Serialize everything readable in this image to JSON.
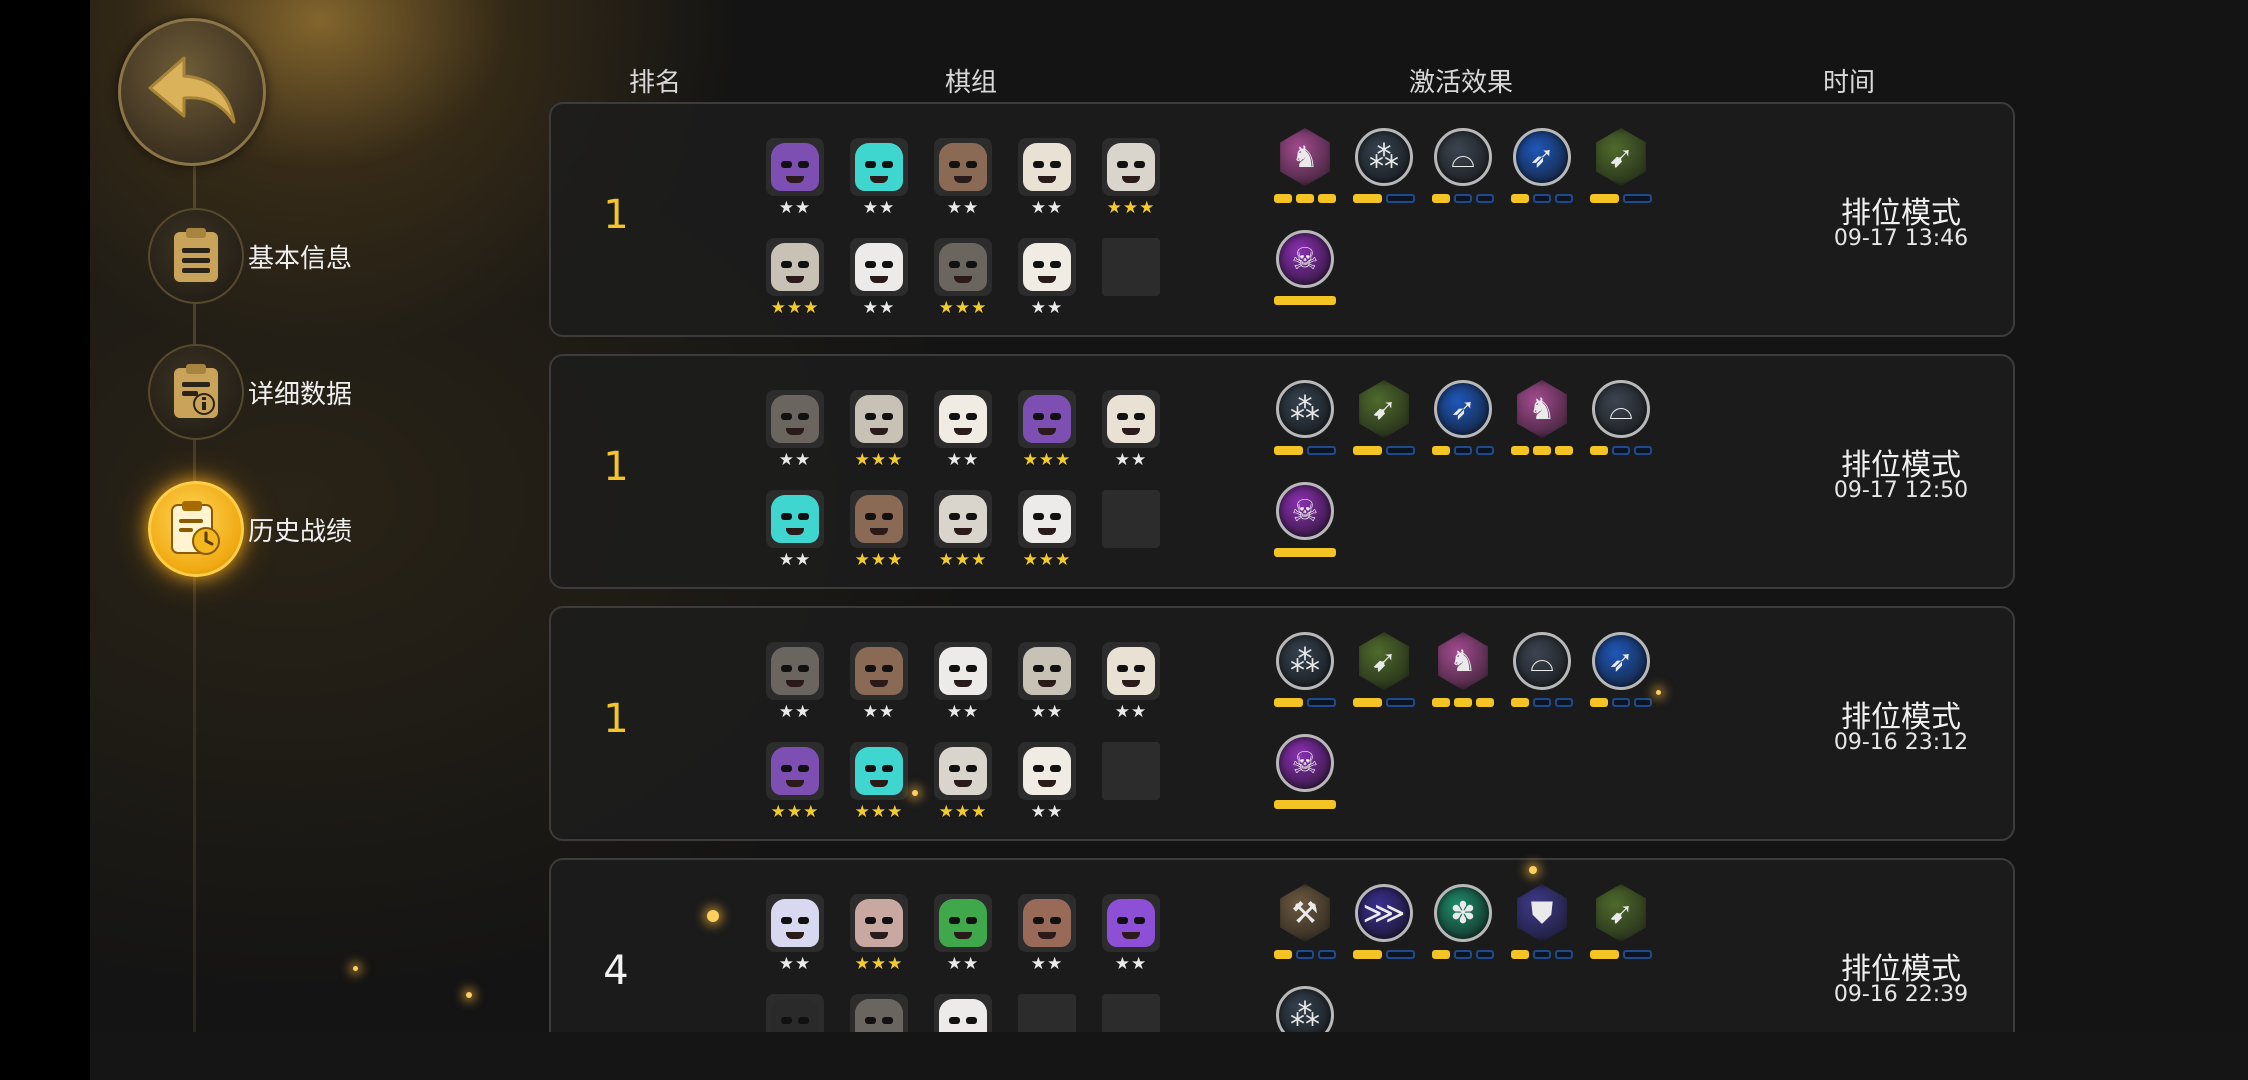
{
  "header": {
    "rank": "排名",
    "lineup": "棋组",
    "traits": "激活效果",
    "time": "时间"
  },
  "nav": [
    {
      "label": "基本信息",
      "icon": "clipboard-icon",
      "active": false
    },
    {
      "label": "详细数据",
      "icon": "info-document-icon",
      "active": false
    },
    {
      "label": "历史战绩",
      "icon": "history-clock-icon",
      "active": true
    }
  ],
  "colors": {
    "accent": "#f4c52a",
    "pip_on": "#f3c424",
    "pip_off_border": "#1f4b8c"
  },
  "matches": [
    {
      "rank": "1",
      "rank_color": "gold",
      "mode": "排位模式",
      "time": "09-17 13:46",
      "units": [
        {
          "color": "#7d4fb3",
          "stars": "★★"
        },
        {
          "color": "#3fd6d0",
          "stars": "★★"
        },
        {
          "color": "#8a6a55",
          "stars": "★★"
        },
        {
          "color": "#e9e2d4",
          "stars": "★★"
        },
        {
          "color": "#d9d4cc",
          "stars": "★★★"
        },
        {
          "color": "#c8c2b6",
          "stars": "★★★"
        },
        {
          "color": "#ecebea",
          "stars": "★★"
        },
        {
          "color": "#6b6560",
          "stars": "★★★"
        },
        {
          "color": "#f0ece4",
          "stars": "★★"
        },
        {
          "empty": true
        }
      ],
      "traits": [
        {
          "icon": "knight-icon",
          "color": "#a24b8f",
          "pips": [
            1,
            1,
            1
          ]
        },
        {
          "icon": "footprints-icon",
          "color": "#34414e",
          "pips": [
            1,
            0
          ]
        },
        {
          "icon": "hat-icon",
          "color": "#3b4450",
          "pips": [
            1,
            0,
            0
          ]
        },
        {
          "icon": "feather-icon",
          "color": "#1f57b8",
          "pips": [
            1,
            0,
            0
          ]
        },
        {
          "icon": "bow-icon",
          "color": "#4f6a2c",
          "pips": [
            1,
            0
          ]
        },
        {
          "icon": "demon-icon",
          "color": "#8a2fb2",
          "pips": [
            1
          ]
        }
      ]
    },
    {
      "rank": "1",
      "rank_color": "gold",
      "mode": "排位模式",
      "time": "09-17 12:50",
      "units": [
        {
          "color": "#6b6560",
          "stars": "★★"
        },
        {
          "color": "#c8c2b6",
          "stars": "★★★"
        },
        {
          "color": "#f0ece4",
          "stars": "★★"
        },
        {
          "color": "#7d4fb3",
          "stars": "★★★"
        },
        {
          "color": "#e9e2d4",
          "stars": "★★"
        },
        {
          "color": "#3fd6d0",
          "stars": "★★"
        },
        {
          "color": "#8a6a55",
          "stars": "★★★"
        },
        {
          "color": "#d9d4cc",
          "stars": "★★★"
        },
        {
          "color": "#ecebea",
          "stars": "★★★"
        },
        {
          "empty": true
        }
      ],
      "traits": [
        {
          "icon": "footprints-icon",
          "color": "#34414e",
          "pips": [
            1,
            0
          ]
        },
        {
          "icon": "bow-icon",
          "color": "#4f6a2c",
          "pips": [
            1,
            0
          ]
        },
        {
          "icon": "feather-icon",
          "color": "#1f57b8",
          "pips": [
            1,
            0,
            0
          ]
        },
        {
          "icon": "knight-icon",
          "color": "#a24b8f",
          "pips": [
            1,
            1,
            1
          ]
        },
        {
          "icon": "hat-icon",
          "color": "#3b4450",
          "pips": [
            1,
            0,
            0
          ]
        },
        {
          "icon": "demon-icon",
          "color": "#8a2fb2",
          "pips": [
            1
          ]
        }
      ]
    },
    {
      "rank": "1",
      "rank_color": "gold",
      "mode": "排位模式",
      "time": "09-16 23:12",
      "units": [
        {
          "color": "#6b6560",
          "stars": "★★"
        },
        {
          "color": "#8a6a55",
          "stars": "★★"
        },
        {
          "color": "#ecebea",
          "stars": "★★"
        },
        {
          "color": "#c8c2b6",
          "stars": "★★"
        },
        {
          "color": "#e9e2d4",
          "stars": "★★"
        },
        {
          "color": "#7d4fb3",
          "stars": "★★★"
        },
        {
          "color": "#3fd6d0",
          "stars": "★★★"
        },
        {
          "color": "#d9d4cc",
          "stars": "★★★"
        },
        {
          "color": "#f0ece4",
          "stars": "★★"
        },
        {
          "empty": true
        }
      ],
      "traits": [
        {
          "icon": "footprints-icon",
          "color": "#34414e",
          "pips": [
            1,
            0
          ]
        },
        {
          "icon": "bow-icon",
          "color": "#4f6a2c",
          "pips": [
            1,
            0
          ]
        },
        {
          "icon": "knight-icon",
          "color": "#a24b8f",
          "pips": [
            1,
            1,
            1
          ]
        },
        {
          "icon": "hat-icon",
          "color": "#3b4450",
          "pips": [
            1,
            0,
            0
          ]
        },
        {
          "icon": "feather-icon",
          "color": "#1f57b8",
          "pips": [
            1,
            0,
            0
          ]
        },
        {
          "icon": "demon-icon",
          "color": "#8a2fb2",
          "pips": [
            1
          ]
        }
      ]
    },
    {
      "rank": "4",
      "rank_color": "white",
      "mode": "排位模式",
      "time": "09-16 22:39",
      "units": [
        {
          "color": "#d8d8f0",
          "stars": "★★"
        },
        {
          "color": "#c8a8a0",
          "stars": "★★★"
        },
        {
          "color": "#3fa84a",
          "stars": "★★"
        },
        {
          "color": "#9a6a58",
          "stars": "★★"
        },
        {
          "color": "#8d4fd6",
          "stars": "★★"
        },
        {
          "color": "#2a2a2a",
          "stars": ""
        },
        {
          "color": "#6b6560",
          "stars": ""
        },
        {
          "color": "#ecebea",
          "stars": ""
        },
        {
          "empty": true
        },
        {
          "empty": true
        }
      ],
      "traits": [
        {
          "icon": "axe-icon",
          "color": "#6d5a40",
          "pips": [
            1,
            0,
            0
          ]
        },
        {
          "icon": "fishbone-icon",
          "color": "#3a2f8f",
          "pips": [
            1,
            0
          ]
        },
        {
          "icon": "paw-icon",
          "color": "#1e8a6a",
          "pips": [
            1,
            0,
            0
          ]
        },
        {
          "icon": "shield-emblem-icon",
          "color": "#3d3a8a",
          "pips": [
            1,
            0,
            0
          ]
        },
        {
          "icon": "bow-icon",
          "color": "#4f6a2c",
          "pips": [
            1,
            0
          ]
        },
        {
          "icon": "footprints-icon",
          "color": "#34414e",
          "pips": []
        }
      ]
    }
  ]
}
